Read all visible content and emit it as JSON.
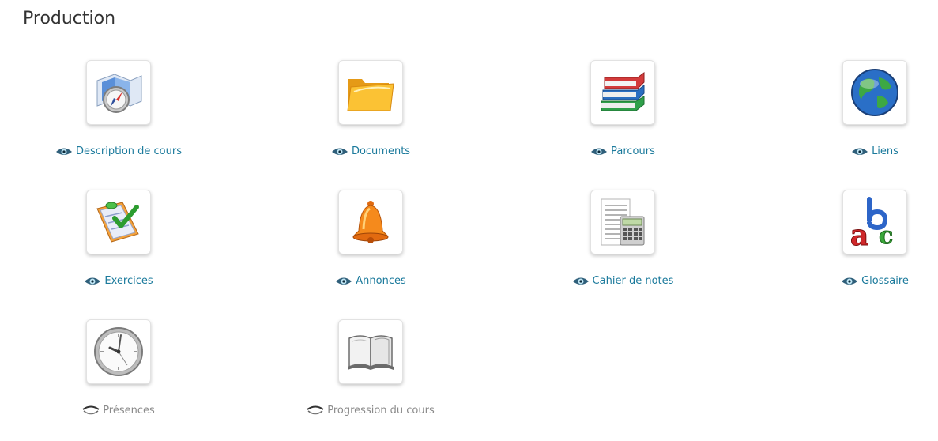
{
  "section": {
    "title": "Production"
  },
  "tools": [
    {
      "id": "description",
      "label": "Description de cours",
      "icon": "compass-map-icon",
      "visible": true
    },
    {
      "id": "documents",
      "label": "Documents",
      "icon": "folder-icon",
      "visible": true
    },
    {
      "id": "parcours",
      "label": "Parcours",
      "icon": "books-icon",
      "visible": true
    },
    {
      "id": "liens",
      "label": "Liens",
      "icon": "globe-icon",
      "visible": true
    },
    {
      "id": "exercices",
      "label": "Exercices",
      "icon": "checklist-icon",
      "visible": true
    },
    {
      "id": "annonces",
      "label": "Annonces",
      "icon": "bell-icon",
      "visible": true
    },
    {
      "id": "cahier",
      "label": "Cahier de notes",
      "icon": "calculator-icon",
      "visible": true
    },
    {
      "id": "glossaire",
      "label": "Glossaire",
      "icon": "abc-icon",
      "visible": true
    },
    {
      "id": "presences",
      "label": "Présences",
      "icon": "clock-icon",
      "visible": false
    },
    {
      "id": "progression",
      "label": "Progression du cours",
      "icon": "open-book-icon",
      "visible": false
    }
  ],
  "colors": {
    "link": "#1b7a9c",
    "hidden": "#8a8a8a",
    "title": "#333333"
  }
}
